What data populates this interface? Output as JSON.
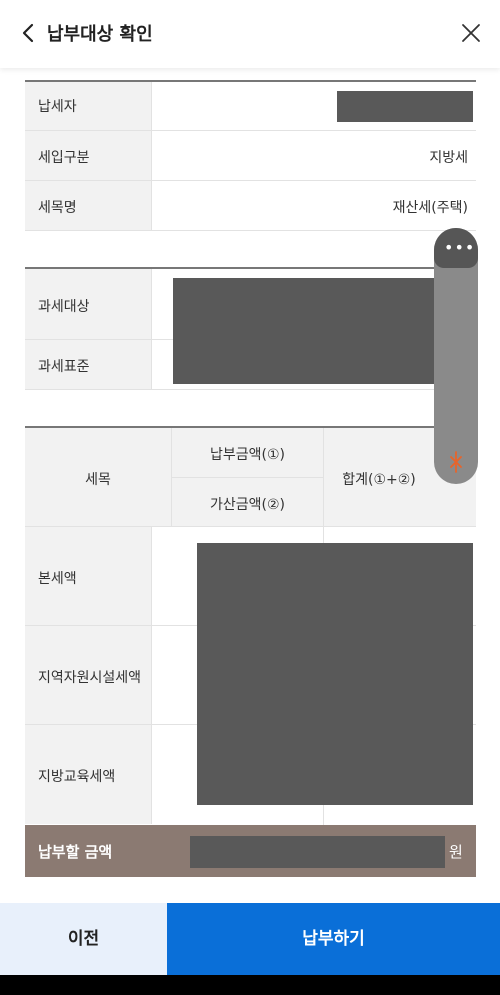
{
  "header": {
    "title": "납부대상 확인",
    "back_icon": "chevron-left-icon",
    "close_icon": "close-icon"
  },
  "info_table": {
    "rows": [
      {
        "label": "납세자",
        "value": ""
      },
      {
        "label": "세입구분",
        "value": "지방세"
      },
      {
        "label": "세목명",
        "value": "재산세(주택)"
      }
    ]
  },
  "tax_base_table": {
    "rows": [
      {
        "label": "과세대상"
      },
      {
        "label": "과세표준"
      }
    ]
  },
  "amount_table": {
    "headers": {
      "item": "세목",
      "payment": "납부금액(①)",
      "penalty": "가산금액(②)",
      "total": "합계(①+②)"
    },
    "rows": [
      {
        "label": "본세액"
      },
      {
        "label": "지역자원시설세액"
      },
      {
        "label": "지방교육세액"
      }
    ]
  },
  "total": {
    "label": "납부할 금액",
    "unit": "원"
  },
  "footer": {
    "prev_label": "이전",
    "pay_label": "납부하기"
  },
  "colors": {
    "primary": "#0a6fd8",
    "total_bar": "#8b7a72",
    "mask": "#595959"
  }
}
